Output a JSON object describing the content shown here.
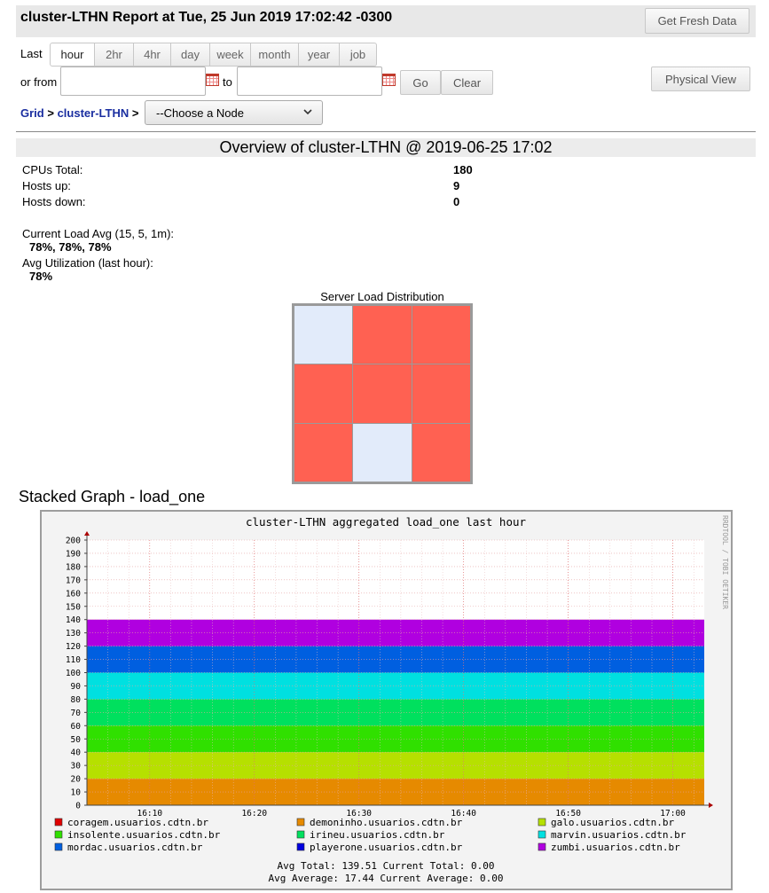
{
  "header": {
    "title": "cluster-LTHN Report at Tue, 25 Jun 2019 17:02:42 -0300",
    "fresh_button": "Get Fresh Data"
  },
  "controls": {
    "last_label": "Last",
    "ranges": [
      {
        "label": "hour",
        "active": true
      },
      {
        "label": "2hr",
        "active": false
      },
      {
        "label": "4hr",
        "active": false
      },
      {
        "label": "day",
        "active": false
      },
      {
        "label": "week",
        "active": false
      },
      {
        "label": "month",
        "active": false
      },
      {
        "label": "year",
        "active": false
      },
      {
        "label": "job",
        "active": false
      }
    ],
    "or_from_label": "or from",
    "from_value": "",
    "to_label": "to",
    "to_value": "",
    "go_button": "Go",
    "clear_button": "Clear",
    "physical_view_button": "Physical View"
  },
  "breadcrumb": {
    "grid": "Grid",
    "sep1": ">",
    "cluster": "cluster-LTHN",
    "sep2": ">",
    "node_select": "--Choose a Node"
  },
  "overview": {
    "title": "Overview of cluster-LTHN @ 2019-06-25 17:02",
    "cpus_label": "CPUs Total:",
    "cpus_value": "180",
    "hosts_up_label": "Hosts up:",
    "hosts_up_value": "9",
    "hosts_down_label": "Hosts down:",
    "hosts_down_value": "0",
    "load_avg_label": "Current Load Avg (15, 5, 1m):",
    "load_avg_value": "78%, 78%, 78%",
    "avg_util_label": "Avg Utilization (last hour):",
    "avg_util_value": "78%"
  },
  "server_load": {
    "title": "Server Load Distribution",
    "colors": {
      "high": "#ff6152",
      "low": "#e2ebfa"
    },
    "cells": [
      "low",
      "high",
      "high",
      "high",
      "high",
      "high",
      "high",
      "low",
      "high"
    ]
  },
  "stacked": {
    "title": "Stacked Graph - load_one"
  },
  "chart_data": {
    "type": "area",
    "title": "cluster-LTHN aggregated load_one last hour",
    "watermark": "RRDTOOL / TOBI OETIKER",
    "ylim": [
      0,
      200
    ],
    "yticks": [
      0,
      10,
      20,
      30,
      40,
      50,
      60,
      70,
      80,
      90,
      100,
      110,
      120,
      130,
      140,
      150,
      160,
      170,
      180,
      190,
      200
    ],
    "xticks": [
      "16:10",
      "16:20",
      "16:30",
      "16:40",
      "16:50",
      "17:00"
    ],
    "x_range": [
      "16:04",
      "17:03"
    ],
    "grid": true,
    "stacked": true,
    "series": [
      {
        "name": "coragem.usuarios.cdtn.br",
        "color": "#e00000",
        "value": 0
      },
      {
        "name": "demoninho.usuarios.cdtn.br",
        "color": "#e68a00",
        "value": 20
      },
      {
        "name": "galo.usuarios.cdtn.br",
        "color": "#b6e000",
        "value": 20
      },
      {
        "name": "insolente.usuarios.cdtn.br",
        "color": "#30e000",
        "value": 20
      },
      {
        "name": "irineu.usuarios.cdtn.br",
        "color": "#00e05e",
        "value": 20
      },
      {
        "name": "marvin.usuarios.cdtn.br",
        "color": "#00e0e0",
        "value": 20
      },
      {
        "name": "mordac.usuarios.cdtn.br",
        "color": "#005fe0",
        "value": 20
      },
      {
        "name": "playerone.usuarios.cdtn.br",
        "color": "#0000e0",
        "value": 0
      },
      {
        "name": "zumbi.usuarios.cdtn.br",
        "color": "#b000e0",
        "value": 20
      }
    ],
    "avg_total_label": "Avg Total:",
    "avg_total": "139.51",
    "current_total_label": "Current Total:",
    "current_total": "0.00",
    "avg_average_label": "Avg Average:",
    "avg_average": "17.44",
    "current_average_label": "Current Average:",
    "current_average": "0.00"
  }
}
